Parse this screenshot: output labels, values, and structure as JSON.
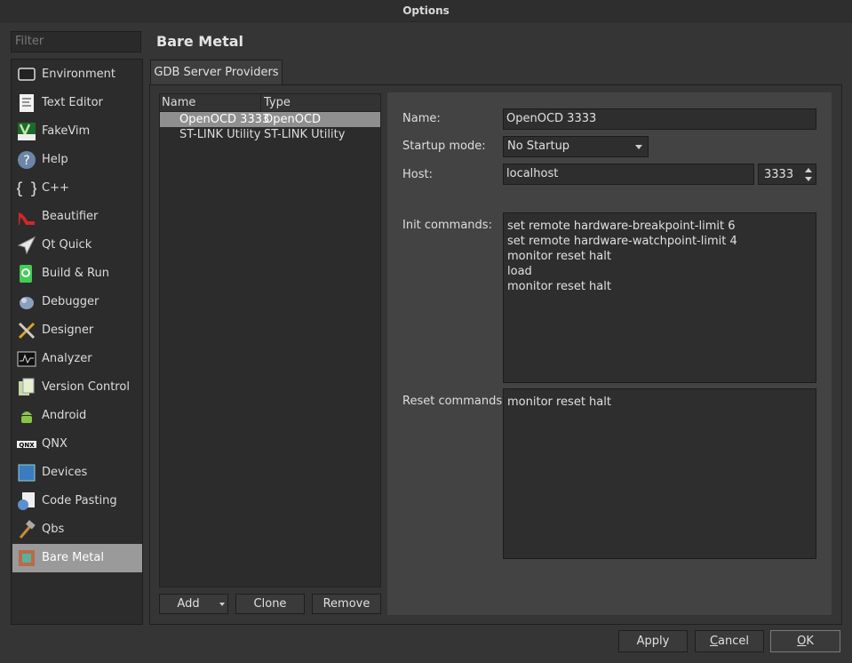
{
  "window": {
    "title": "Options"
  },
  "filter": {
    "placeholder": "Filter"
  },
  "categories": [
    {
      "label": "Environment",
      "icon": "monitor-icon"
    },
    {
      "label": "Text Editor",
      "icon": "text-editor-icon"
    },
    {
      "label": "FakeVim",
      "icon": "fakevim-icon"
    },
    {
      "label": "Help",
      "icon": "help-icon"
    },
    {
      "label": "C++",
      "icon": "cpp-braces-icon"
    },
    {
      "label": "Beautifier",
      "icon": "high-heel-icon"
    },
    {
      "label": "Qt Quick",
      "icon": "paper-plane-icon"
    },
    {
      "label": "Build & Run",
      "icon": "build-run-icon"
    },
    {
      "label": "Debugger",
      "icon": "bug-icon"
    },
    {
      "label": "Designer",
      "icon": "designer-tools-icon"
    },
    {
      "label": "Analyzer",
      "icon": "oscilloscope-icon"
    },
    {
      "label": "Version Control",
      "icon": "version-control-icon"
    },
    {
      "label": "Android",
      "icon": "android-icon"
    },
    {
      "label": "QNX",
      "icon": "qnx-icon"
    },
    {
      "label": "Devices",
      "icon": "devices-icon"
    },
    {
      "label": "Code Pasting",
      "icon": "code-pasting-icon"
    },
    {
      "label": "Qbs",
      "icon": "hammer-icon"
    },
    {
      "label": "Bare Metal",
      "icon": "chip-icon"
    }
  ],
  "selected_category": "Bare Metal",
  "page": {
    "title": "Bare Metal",
    "tab": "GDB Server Providers"
  },
  "providers": {
    "columns": [
      "Name",
      "Type"
    ],
    "rows": [
      {
        "name": "OpenOCD 3333",
        "type": "OpenOCD"
      },
      {
        "name": "ST-LINK Utility",
        "type": "ST-LINK Utility"
      }
    ],
    "selected_index": 0,
    "buttons": {
      "add": "Add",
      "clone": "Clone",
      "remove": "Remove"
    }
  },
  "form": {
    "name_label": "Name:",
    "name_value": "OpenOCD 3333",
    "startup_label": "Startup mode:",
    "startup_value": "No Startup",
    "host_label": "Host:",
    "host_value": "localhost",
    "port_value": "3333",
    "init_label": "Init commands:",
    "init_value": "set remote hardware-breakpoint-limit 6\nset remote hardware-watchpoint-limit 4\nmonitor reset halt\nload\nmonitor reset halt",
    "reset_label": "Reset commands:",
    "reset_value": "monitor reset halt"
  },
  "dialog_buttons": {
    "apply": "Apply",
    "cancel_mnemonic": "C",
    "cancel_rest": "ancel",
    "ok_mnemonic": "O",
    "ok_rest": "K"
  },
  "colors": {
    "selection": "#9a9a9a",
    "background": "#353535",
    "form_panel": "#434343"
  }
}
